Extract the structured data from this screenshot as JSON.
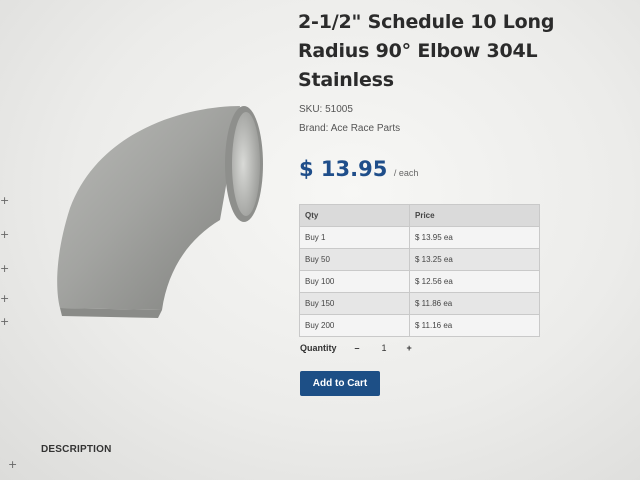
{
  "product": {
    "title": "2-1/2\" Schedule 10 Long Radius 90° Elbow 304L Stainless",
    "sku": "SKU: 51005",
    "brand": "Brand: Ace Race Parts",
    "price": "$ 13.95",
    "price_unit": "/ each"
  },
  "pricing_table": {
    "headers": [
      "Qty",
      "Price"
    ],
    "rows": [
      [
        "Buy 1",
        "$ 13.95 ea"
      ],
      [
        "Buy 50",
        "$ 13.25 ea"
      ],
      [
        "Buy 100",
        "$ 12.56 ea"
      ],
      [
        "Buy 150",
        "$ 11.86 ea"
      ],
      [
        "Buy 200",
        "$ 11.16 ea"
      ]
    ]
  },
  "quantity": {
    "label": "Quantity",
    "decrement": "–",
    "value": "1",
    "increment": "+"
  },
  "add_to_cart_label": "Add to Cart",
  "description_tab": "DESCRIPTION",
  "edge_marker": "+",
  "image": {
    "icon": "stainless-elbow-image",
    "tone": "#9a9b98"
  },
  "colors": {
    "accent": "#1d4f86",
    "price": "#1f4e8a"
  }
}
